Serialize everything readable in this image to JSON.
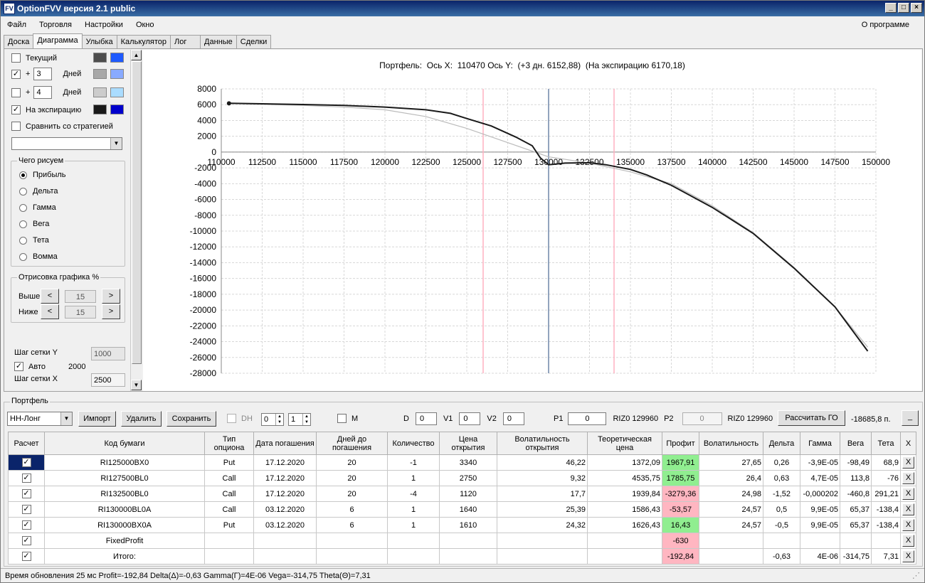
{
  "app": {
    "title": "OptionFVV версия 2.1 public",
    "icon_text": "FV"
  },
  "menu": {
    "items": [
      "Файл",
      "Торговля",
      "Настройки",
      "Окно"
    ],
    "about": "О программе"
  },
  "tabs": [
    "Доска",
    "Диаграмма",
    "Улыбка",
    "Калькулятор",
    "Лог",
    "Данные",
    "Сделки"
  ],
  "active_tab": 1,
  "left": {
    "current_label": "Текущий",
    "days_prefix": "+",
    "days_label": "Дней",
    "days1_value": "3",
    "days2_value": "4",
    "expiry_label": "На экспирацию",
    "compare_label": "Сравнить со стратегией",
    "what_label": "Чего рисуем",
    "radios": [
      "Прибыль",
      "Дельта",
      "Гамма",
      "Вега",
      "Тета",
      "Вомма"
    ],
    "draw_label": "Отрисовка графика %",
    "above_label": "Выше",
    "below_label": "Ниже",
    "above_value": "15",
    "below_value": "15",
    "prev_glyph": "<",
    "next_glyph": ">",
    "grid_y_label": "Шаг сетки Y",
    "grid_y_value": "1000",
    "auto_label": "Авто",
    "auto_value": "2000",
    "grid_x_label": "Шаг сетки X",
    "grid_x_value": "2500",
    "checked_glyph": "✓",
    "checkbox_states": {
      "current": false,
      "days1": true,
      "days2": false,
      "expiry": true,
      "compare": false,
      "auto": true
    },
    "selected_radio": 0,
    "colors": {
      "current": [
        "#4d4d4d",
        "#1e5aff"
      ],
      "days1": [
        "#a8a8a8",
        "#88aaff"
      ],
      "days2": [
        "#cccccc",
        "#aadcff"
      ],
      "expiry": [
        "#1a1a1a",
        "#0000cc"
      ]
    }
  },
  "main_chart": {
    "header": {
      "portfolio": "Портфель:",
      "axis_x_label": "Ось X:",
      "axis_x_value": "110470",
      "axis_y_label": "Ось Y:",
      "days3": "(+3 дн. 6152,88)",
      "expiry": "(На экспирацию 6170,18)"
    }
  },
  "chart_data": {
    "type": "line",
    "x_ticks": [
      "110000",
      "112500",
      "115000",
      "117500",
      "120000",
      "122500",
      "125000",
      "127500",
      "130000",
      "132500",
      "135000",
      "137500",
      "140000",
      "142500",
      "145000",
      "147500",
      "150000"
    ],
    "y_ticks": [
      "8000",
      "6000",
      "4000",
      "2000",
      "0",
      "-2000",
      "-4000",
      "-6000",
      "-8000",
      "-10000",
      "-12000",
      "-14000",
      "-16000",
      "-18000",
      "-20000",
      "-22000",
      "-24000",
      "-26000",
      "-28000"
    ],
    "xlim": [
      110000,
      150000
    ],
    "ylim": [
      -28000,
      8000
    ],
    "grid": true,
    "series": [
      {
        "color": "#1a1a1a",
        "x": [
          110470,
          112500,
          115000,
          117500,
          120000,
          122500,
          124000,
          125000,
          126500,
          128000,
          129000,
          129500,
          130000,
          130500,
          131000,
          132500,
          133500,
          135000,
          136000,
          137500,
          140000,
          142500,
          145000,
          147500,
          149500
        ],
        "y": [
          6170,
          6110,
          6020,
          5900,
          5700,
          5350,
          4900,
          4250,
          3300,
          1900,
          800,
          -750,
          -1600,
          -1500,
          -1400,
          -1350,
          -1600,
          -2200,
          -2900,
          -4200,
          -7000,
          -10300,
          -14700,
          -19600,
          -25200
        ]
      },
      {
        "color": "#bbbbbb",
        "x": [
          110470,
          112500,
          115000,
          117500,
          120000,
          122500,
          125000,
          127500,
          130000,
          132500,
          135000,
          137500,
          140000,
          142500,
          145000,
          147500,
          149500
        ],
        "y": [
          6153,
          6050,
          5900,
          5700,
          5350,
          4500,
          3000,
          1200,
          -600,
          -1400,
          -2500,
          -4000,
          -6800,
          -10200,
          -14600,
          -19600,
          -24700
        ]
      }
    ],
    "markers": [
      {
        "x": 126000,
        "color": "#ffb0c0"
      },
      {
        "x": 130000,
        "color": "#6f86a8"
      },
      {
        "x": 134000,
        "color": "#ffb0c0"
      }
    ]
  },
  "portfolio": {
    "group_label": "Портфель",
    "selected": "НН-Лонг",
    "import": "Импорт",
    "delete": "Удалить",
    "save": "Сохранить",
    "dh_label": "DH",
    "spin1": "0",
    "spin2": "1",
    "m_label": "M",
    "d_label": "D",
    "d_value": "0",
    "v1_label": "V1",
    "v1_value": "0",
    "v2_label": "V2",
    "v2_value": "0",
    "p1_label": "P1",
    "p1_value": "0",
    "riz_text1": "RIZ0 129960",
    "p2_label": "P2",
    "p2_value": "0",
    "riz_text2": "RIZ0 129960",
    "calc_label": "Рассчитать ГО",
    "go_value": "-18685,8 п.",
    "minimize": "_"
  },
  "grid": {
    "headers": [
      "Расчет",
      "Код бумаги",
      "Тип опциона",
      "Дата погашения",
      "Дней до погашения",
      "Количество",
      "Цена открытия",
      "Волатильность открытия",
      "Теоретическая цена",
      "Профит",
      "Волатильность",
      "Дельта",
      "Гамма",
      "Вега",
      "Тета",
      "X"
    ],
    "rows": [
      {
        "checked": true,
        "selected": true,
        "code": "RI125000BX0",
        "type": "Put",
        "date": "17.12.2020",
        "days": "20",
        "qty": "-1",
        "price": "3340",
        "vol_open": "46,22",
        "theor": "1372,09",
        "profit": "1967,91",
        "profit_sign": "pos",
        "vol": "27,65",
        "delta": "0,26",
        "gamma": "-3,9E-05",
        "vega": "-98,49",
        "theta": "68,9",
        "x": "X"
      },
      {
        "checked": true,
        "selected": false,
        "code": "RI127500BL0",
        "type": "Call",
        "date": "17.12.2020",
        "days": "20",
        "qty": "1",
        "price": "2750",
        "vol_open": "9,32",
        "theor": "4535,75",
        "profit": "1785,75",
        "profit_sign": "pos",
        "vol": "26,4",
        "delta": "0,63",
        "gamma": "4,7E-05",
        "vega": "113,8",
        "theta": "-76",
        "x": "X"
      },
      {
        "checked": true,
        "selected": false,
        "code": "RI132500BL0",
        "type": "Call",
        "date": "17.12.2020",
        "days": "20",
        "qty": "-4",
        "price": "1120",
        "vol_open": "17,7",
        "theor": "1939,84",
        "profit": "-3279,36",
        "profit_sign": "neg",
        "vol": "24,98",
        "delta": "-1,52",
        "gamma": "-0,000202",
        "vega": "-460,8",
        "theta": "291,21",
        "x": "X"
      },
      {
        "checked": true,
        "selected": false,
        "code": "RI130000BL0A",
        "type": "Call",
        "date": "03.12.2020",
        "days": "6",
        "qty": "1",
        "price": "1640",
        "vol_open": "25,39",
        "theor": "1586,43",
        "profit": "-53,57",
        "profit_sign": "neg",
        "vol": "24,57",
        "delta": "0,5",
        "gamma": "9,9E-05",
        "vega": "65,37",
        "theta": "-138,4",
        "x": "X"
      },
      {
        "checked": true,
        "selected": false,
        "code": "RI130000BX0A",
        "type": "Put",
        "date": "03.12.2020",
        "days": "6",
        "qty": "1",
        "price": "1610",
        "vol_open": "24,32",
        "theor": "1626,43",
        "profit": "16,43",
        "profit_sign": "pos",
        "vol": "24,57",
        "delta": "-0,5",
        "gamma": "9,9E-05",
        "vega": "65,37",
        "theta": "-138,4",
        "x": "X"
      },
      {
        "checked": true,
        "selected": false,
        "code": "FixedProfit",
        "type": "",
        "date": "",
        "days": "",
        "qty": "",
        "price": "",
        "vol_open": "",
        "theor": "",
        "profit": "-630",
        "profit_sign": "neg",
        "vol": "",
        "delta": "",
        "gamma": "",
        "vega": "",
        "theta": "",
        "x": "X"
      },
      {
        "checked": true,
        "selected": false,
        "code": "Итого:",
        "type": "",
        "date": "",
        "days": "",
        "qty": "",
        "price": "",
        "vol_open": "",
        "theor": "",
        "profit": "-192,84",
        "profit_sign": "neg",
        "vol": "",
        "delta": "-0,63",
        "gamma": "4E-06",
        "vega": "-314,75",
        "theta": "7,31",
        "x": "X"
      }
    ]
  },
  "status": {
    "text": "Время обновления 25 мс  Profit=-192,84 Delta(Δ)=-0,63 Gamma(Γ)=4E-06 Vega=-314,75 Theta(Θ)=7,31"
  }
}
